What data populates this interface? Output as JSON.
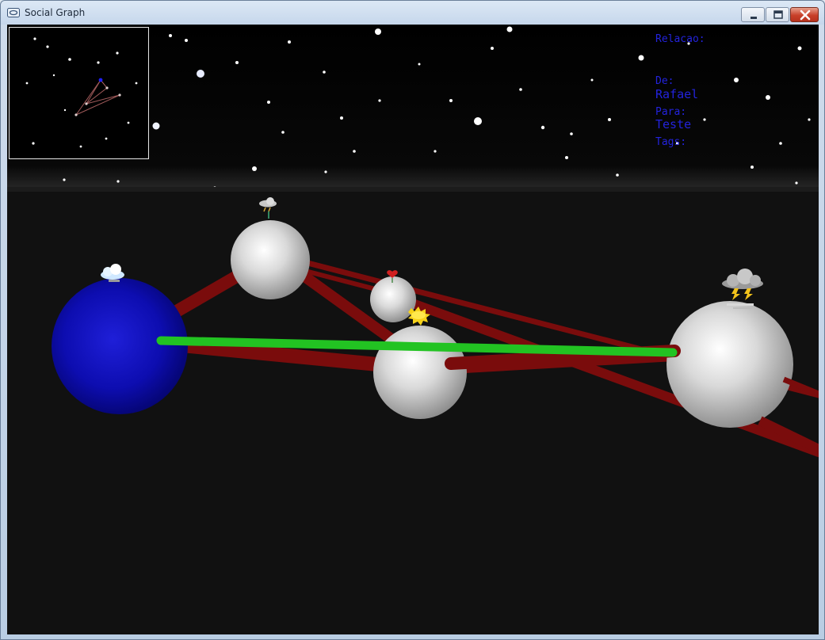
{
  "window": {
    "title": "Social Graph",
    "app_icon": "window-app-icon",
    "controls": [
      "minimize-icon",
      "maximize-icon",
      "close-icon"
    ]
  },
  "info_panel": {
    "relacao_label": "Relacao:",
    "de_label": "De:",
    "de_value": "Rafael",
    "para_label": "Para:",
    "para_value": "Teste",
    "tags_label": "Tags:"
  },
  "graph": {
    "selected_node_color": "#1010c8",
    "node_color": "#d8d8d8",
    "edge_color": "#7a0c0c",
    "selected_edge_color": "#22c322",
    "node_mood_icons": [
      "cloud-icon",
      "rain-cloud-icon",
      "heart-icon",
      "sun-icon",
      "storm-cloud-icon"
    ]
  }
}
